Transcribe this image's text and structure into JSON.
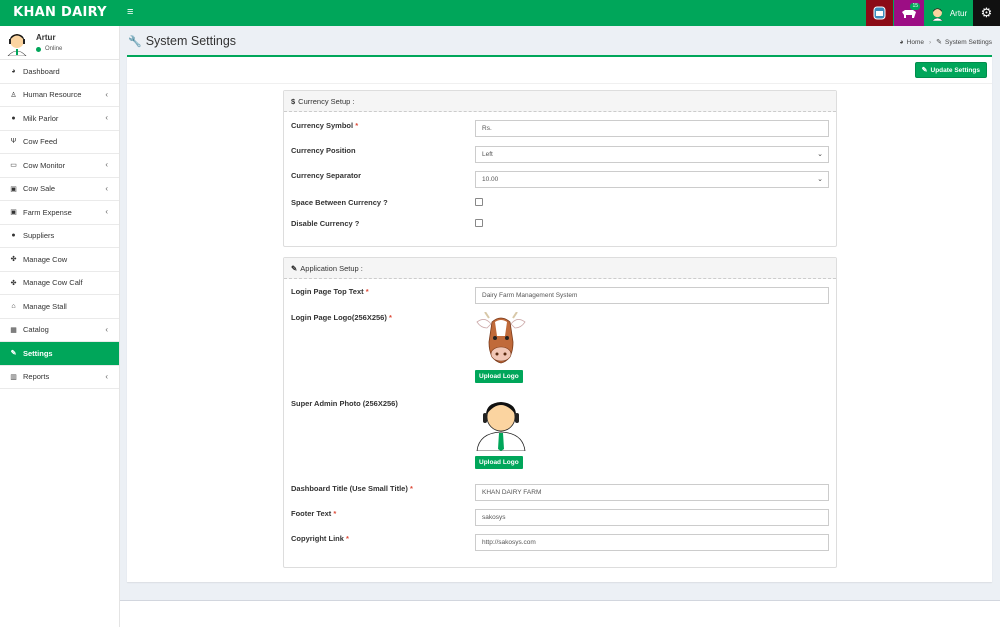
{
  "header": {
    "logo": "KHAN DAIRY",
    "menu_toggle": "≡",
    "badge_count": "15",
    "user_name": "Artur"
  },
  "sidebar": {
    "user": {
      "name": "Artur",
      "status": "Online"
    },
    "items": [
      {
        "label": "Dashboard",
        "icon": "dashboard-icon",
        "glyph": "◕",
        "has_submenu": false,
        "active": false
      },
      {
        "label": "Human Resource",
        "icon": "user-icon",
        "glyph": "♙",
        "has_submenu": true,
        "active": false
      },
      {
        "label": "Milk Parlor",
        "icon": "drop-icon",
        "glyph": "●",
        "has_submenu": true,
        "active": false
      },
      {
        "label": "Cow Feed",
        "icon": "cutlery-icon",
        "glyph": "Ψ",
        "has_submenu": false,
        "active": false
      },
      {
        "label": "Cow Monitor",
        "icon": "monitor-icon",
        "glyph": "▭",
        "has_submenu": true,
        "active": false
      },
      {
        "label": "Cow Sale",
        "icon": "money-icon",
        "glyph": "▣",
        "has_submenu": true,
        "active": false
      },
      {
        "label": "Farm Expense",
        "icon": "money-icon",
        "glyph": "▣",
        "has_submenu": true,
        "active": false
      },
      {
        "label": "Suppliers",
        "icon": "users-icon",
        "glyph": "●",
        "has_submenu": false,
        "active": false
      },
      {
        "label": "Manage Cow",
        "icon": "paw-icon",
        "glyph": "✤",
        "has_submenu": false,
        "active": false
      },
      {
        "label": "Manage Cow Calf",
        "icon": "paw-icon",
        "glyph": "✤",
        "has_submenu": false,
        "active": false
      },
      {
        "label": "Manage Stall",
        "icon": "home-icon",
        "glyph": "⌂",
        "has_submenu": false,
        "active": false
      },
      {
        "label": "Catalog",
        "icon": "list-icon",
        "glyph": "▦",
        "has_submenu": true,
        "active": false
      },
      {
        "label": "Settings",
        "icon": "wrench-icon",
        "glyph": "✎",
        "has_submenu": false,
        "active": true
      },
      {
        "label": "Reports",
        "icon": "chart-icon",
        "glyph": "▥",
        "has_submenu": true,
        "active": false
      }
    ]
  },
  "page": {
    "title": "System Settings",
    "breadcrumb": {
      "home": "Home",
      "current": "System Settings"
    },
    "update_button": "Update Settings"
  },
  "currency_setup": {
    "heading": "Currency Setup :",
    "symbol_label": "Currency Symbol",
    "symbol_value": "Rs.",
    "position_label": "Currency Position",
    "position_value": "Left",
    "separator_label": "Currency Separator",
    "separator_value": "10.00",
    "space_label": "Space Between Currency ?",
    "disable_label": "Disable Currency ?"
  },
  "application_setup": {
    "heading": "Application Setup :",
    "login_text_label": "Login Page Top Text",
    "login_text_value": "Dairy Farm Management System",
    "login_logo_label": "Login Page Logo(256X256)",
    "upload_logo_1": "Upload Logo",
    "admin_photo_label": "Super Admin Photo (256X256)",
    "upload_logo_2": "Upload Logo",
    "dashboard_title_label": "Dashboard Title (Use Small Title)",
    "dashboard_title_value": "KHAN DAIRY FARM",
    "footer_label": "Footer Text",
    "footer_value": "sakosys",
    "copyright_label": "Copyright Link",
    "copyright_value": "http://sakosys.com"
  },
  "colors": {
    "brand": "#00a65a",
    "header_red": "#8b0b16",
    "header_purple": "#9c0d84",
    "required": "#dd4b39"
  }
}
